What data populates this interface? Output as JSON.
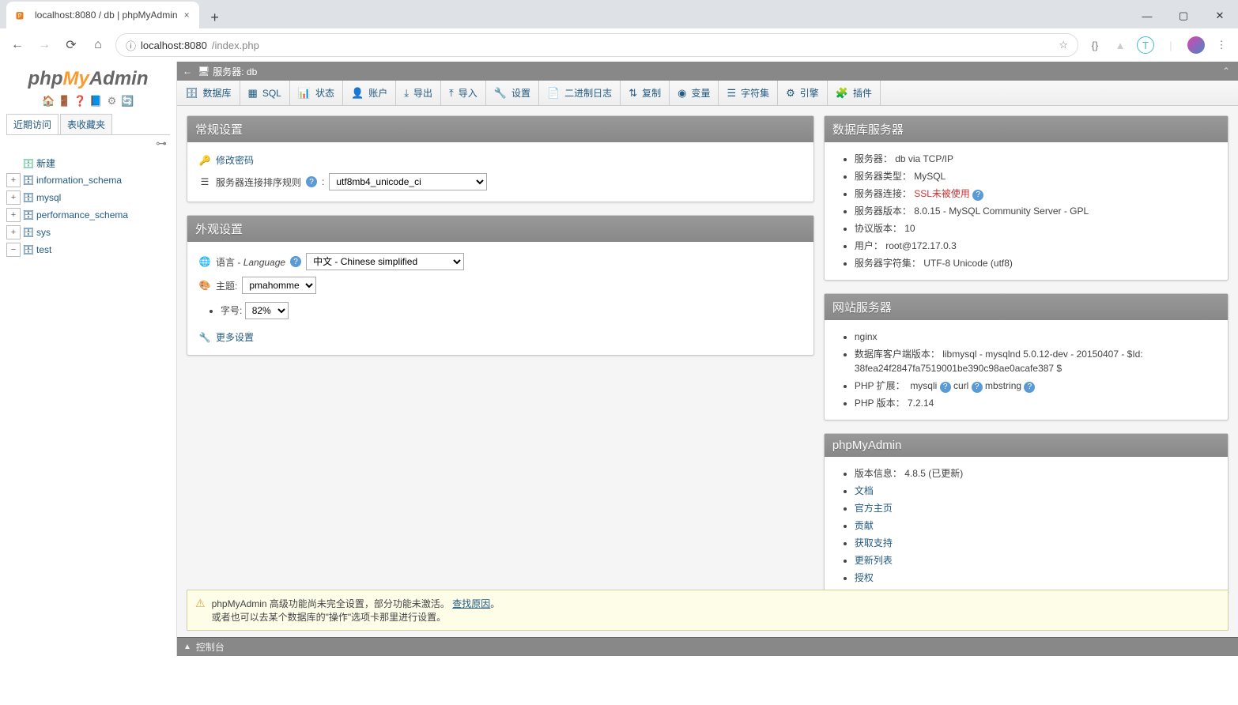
{
  "browser": {
    "tab_title": "localhost:8080 / db | phpMyAdmin",
    "url_host": "localhost",
    "url_port": ":8080",
    "url_path": "/index.php",
    "info_icon_title": "ⓘ"
  },
  "sidebar": {
    "logo": {
      "p1": "php",
      "p2": "My",
      "p3": "Admin"
    },
    "tabs": {
      "recent": "近期访问",
      "favorites": "表收藏夹"
    },
    "new_label": "新建",
    "databases": [
      {
        "name": "information_schema"
      },
      {
        "name": "mysql"
      },
      {
        "name": "performance_schema"
      },
      {
        "name": "sys"
      },
      {
        "name": "test"
      }
    ]
  },
  "topbar": {
    "server_label": "服务器: db"
  },
  "main_tabs": [
    {
      "ic": "ic-db",
      "label": "数据库"
    },
    {
      "ic": "ic-sql",
      "label": "SQL"
    },
    {
      "ic": "ic-status",
      "label": "状态"
    },
    {
      "ic": "ic-user",
      "label": "账户"
    },
    {
      "ic": "ic-export",
      "label": "导出"
    },
    {
      "ic": "ic-import",
      "label": "导入"
    },
    {
      "ic": "ic-gear",
      "label": "设置"
    },
    {
      "ic": "ic-binlog",
      "label": "二进制日志"
    },
    {
      "ic": "ic-repl",
      "label": "复制"
    },
    {
      "ic": "ic-var",
      "label": "变量"
    },
    {
      "ic": "ic-charset",
      "label": "字符集"
    },
    {
      "ic": "ic-engine",
      "label": "引擎"
    },
    {
      "ic": "ic-plugin",
      "label": "插件"
    }
  ],
  "general": {
    "title": "常规设置",
    "change_pw": "修改密码",
    "collation_label": "服务器连接排序规则",
    "collation_value": "utf8mb4_unicode_ci"
  },
  "appearance": {
    "title": "外观设置",
    "lang_label_cn": "语言",
    "lang_label_en": "Language",
    "lang_value": "中文 - Chinese simplified",
    "theme_label": "主题:",
    "theme_value": "pmahomme",
    "fontsize_label": "字号:",
    "fontsize_value": "82%",
    "more_settings": "更多设置"
  },
  "dbserver": {
    "title": "数据库服务器",
    "items": {
      "server": {
        "k": "服务器：",
        "v": "db via TCP/IP"
      },
      "server_type": {
        "k": "服务器类型：",
        "v": "MySQL"
      },
      "server_conn": {
        "k": "服务器连接：",
        "v": "SSL未被使用"
      },
      "server_ver": {
        "k": "服务器版本：",
        "v": "8.0.15 - MySQL Community Server - GPL"
      },
      "proto": {
        "k": "协议版本：",
        "v": "10"
      },
      "user": {
        "k": "用户：",
        "v": "root@172.17.0.3"
      },
      "charset": {
        "k": "服务器字符集：",
        "v": "UTF-8 Unicode (utf8)"
      }
    }
  },
  "webserver": {
    "title": "网站服务器",
    "nginx": "nginx",
    "client_label": "数据库客户端版本：",
    "client_value": "libmysql - mysqlnd 5.0.12-dev - 20150407 - $Id: 38fea24f2847fa7519001be390c98ae0acafe387 $",
    "phpext_label": "PHP 扩展：",
    "phpext_1": "mysqli",
    "phpext_2": "curl",
    "phpext_3": "mbstring",
    "phpver_label": "PHP 版本：",
    "phpver_value": "7.2.14"
  },
  "pma": {
    "title": "phpMyAdmin",
    "version_label": "版本信息：",
    "version_value": "4.8.5 (已更新)",
    "links": [
      "文档",
      "官方主页",
      "贡献",
      "获取支持",
      "更新列表",
      "授权"
    ]
  },
  "notice": {
    "line1_a": "phpMyAdmin 高级功能尚未完全设置，部分功能未激活。",
    "line1_link": "查找原因",
    "line1_b": "。",
    "line2": "或者也可以去某个数据库的\"操作\"选项卡那里进行设置。"
  },
  "console": {
    "label": "控制台"
  }
}
